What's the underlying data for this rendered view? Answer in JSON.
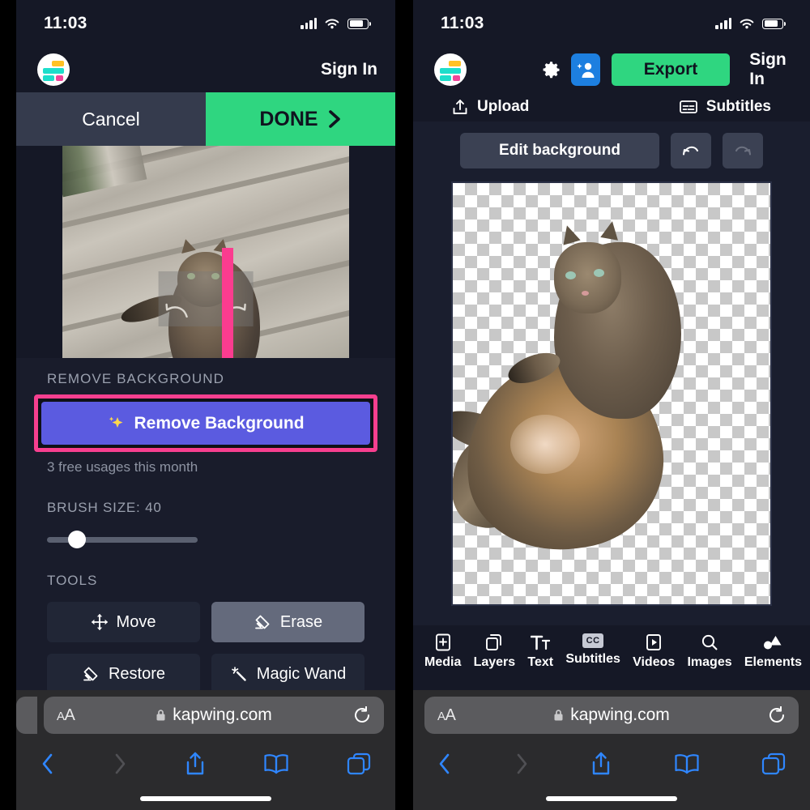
{
  "status": {
    "time": "11:03",
    "signal_icon": "cellular-bars-icon",
    "wifi_icon": "wifi-icon",
    "battery_icon": "battery-icon"
  },
  "left_panel": {
    "app_nav": {
      "logo_icon": "kapwing-logo-icon",
      "sign_in_label": "Sign In"
    },
    "action_bar": {
      "cancel_label": "Cancel",
      "done_label": "DONE",
      "done_chevron_icon": "chevron-right-icon",
      "done_color": "#2fd680",
      "cancel_bg": "#353b4d"
    },
    "preview": {
      "rotate_left_icon": "rotate-left-icon",
      "rotate_right_icon": "rotate-right-icon",
      "annotation_icon": "pink-down-arrow-annotation",
      "annotation_color": "#fb3c8f"
    },
    "remove_background": {
      "section_label": "REMOVE BACKGROUND",
      "button_label": "Remove Background",
      "button_icon": "sparkles-icon",
      "button_color": "#5b5be0",
      "highlight_color": "#f73f8f",
      "note": "3 free usages this month"
    },
    "brush": {
      "label": "BRUSH SIZE: 40",
      "value": 40,
      "min": 0,
      "max": 100
    },
    "tools": {
      "label": "TOOLS",
      "items": [
        {
          "label": "Move",
          "icon": "move-arrows-icon",
          "active": false
        },
        {
          "label": "Erase",
          "icon": "eraser-icon",
          "active": true
        },
        {
          "label": "Restore",
          "icon": "eraser-icon",
          "active": false
        },
        {
          "label": "Magic Wand",
          "icon": "magic-wand-icon",
          "active": false
        }
      ]
    }
  },
  "right_panel": {
    "app_nav": {
      "logo_icon": "kapwing-logo-icon",
      "settings_icon": "gear-icon",
      "collaborate_icon": "add-person-icon",
      "collaborate_color": "#1d7fe0",
      "export_label": "Export",
      "export_color": "#2fd680",
      "sign_in_label": "Sign In"
    },
    "sub_nav": {
      "upload_label": "Upload",
      "upload_icon": "upload-icon",
      "subtitles_label": "Subtitles",
      "subtitles_icon": "subtitles-icon"
    },
    "canvas_toolbar": {
      "edit_background_label": "Edit background",
      "undo_icon": "undo-arrow-icon",
      "redo_icon": "redo-arrow-icon",
      "undo_enabled": true,
      "redo_enabled": false
    },
    "canvas": {
      "content_icon": "cat-cutout-image",
      "background": "transparency-checkerboard"
    },
    "app_tabs": [
      {
        "label": "Media",
        "icon": "media-add-icon"
      },
      {
        "label": "Layers",
        "icon": "layers-icon"
      },
      {
        "label": "Text",
        "icon": "text-icon"
      },
      {
        "label": "Subtitles",
        "icon": "cc-icon",
        "badge": "CC"
      },
      {
        "label": "Videos",
        "icon": "video-icon"
      },
      {
        "label": "Images",
        "icon": "search-icon"
      },
      {
        "label": "Elements",
        "icon": "shapes-icon"
      }
    ]
  },
  "browser": {
    "text_size_label": "AA",
    "lock_icon": "lock-icon",
    "url": "kapwing.com",
    "reload_icon": "reload-icon",
    "back_icon": "chevron-left-icon",
    "forward_icon": "chevron-right-icon",
    "share_icon": "share-icon",
    "bookmarks_icon": "book-icon",
    "tabs_icon": "tabs-icon",
    "accent": "#2f86ff",
    "chrome_bg": "#2b2b2d"
  }
}
